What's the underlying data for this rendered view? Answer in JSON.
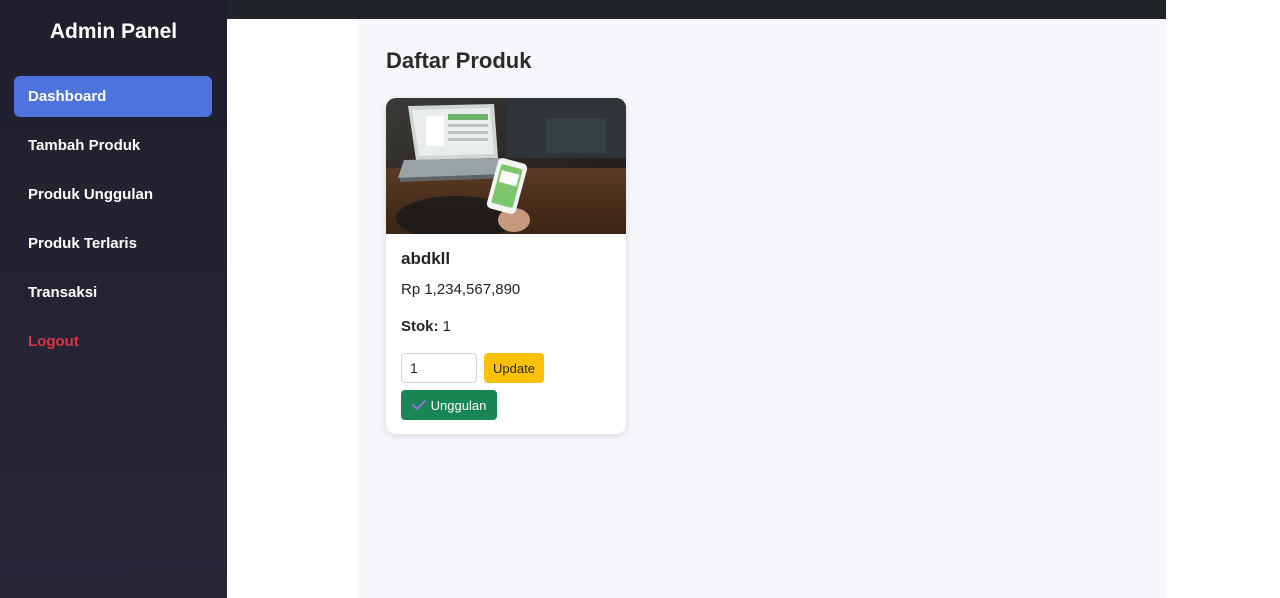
{
  "sidebar": {
    "title": "Admin Panel",
    "items": [
      {
        "label": "Dashboard",
        "active": true
      },
      {
        "label": "Tambah Produk",
        "active": false
      },
      {
        "label": "Produk Unggulan",
        "active": false
      },
      {
        "label": "Produk Terlaris",
        "active": false
      },
      {
        "label": "Transaksi",
        "active": false
      },
      {
        "label": "Logout",
        "active": false
      }
    ]
  },
  "main": {
    "title": "Daftar Produk",
    "product": {
      "name": "abdkll",
      "price": "Rp 1,234,567,890",
      "stock_label": "Stok:",
      "stock_value": "1",
      "stock_input_value": "1",
      "update_label": "Update",
      "featured_label": "Unggulan",
      "featured_icon": "check-icon"
    }
  },
  "colors": {
    "sidebar_bg": "#1f1f2e",
    "active_item": "#4e73df",
    "logout": "#dc3545",
    "update_button": "#ffc107",
    "featured_button": "#198754",
    "content_bg": "#f6f7fb"
  }
}
